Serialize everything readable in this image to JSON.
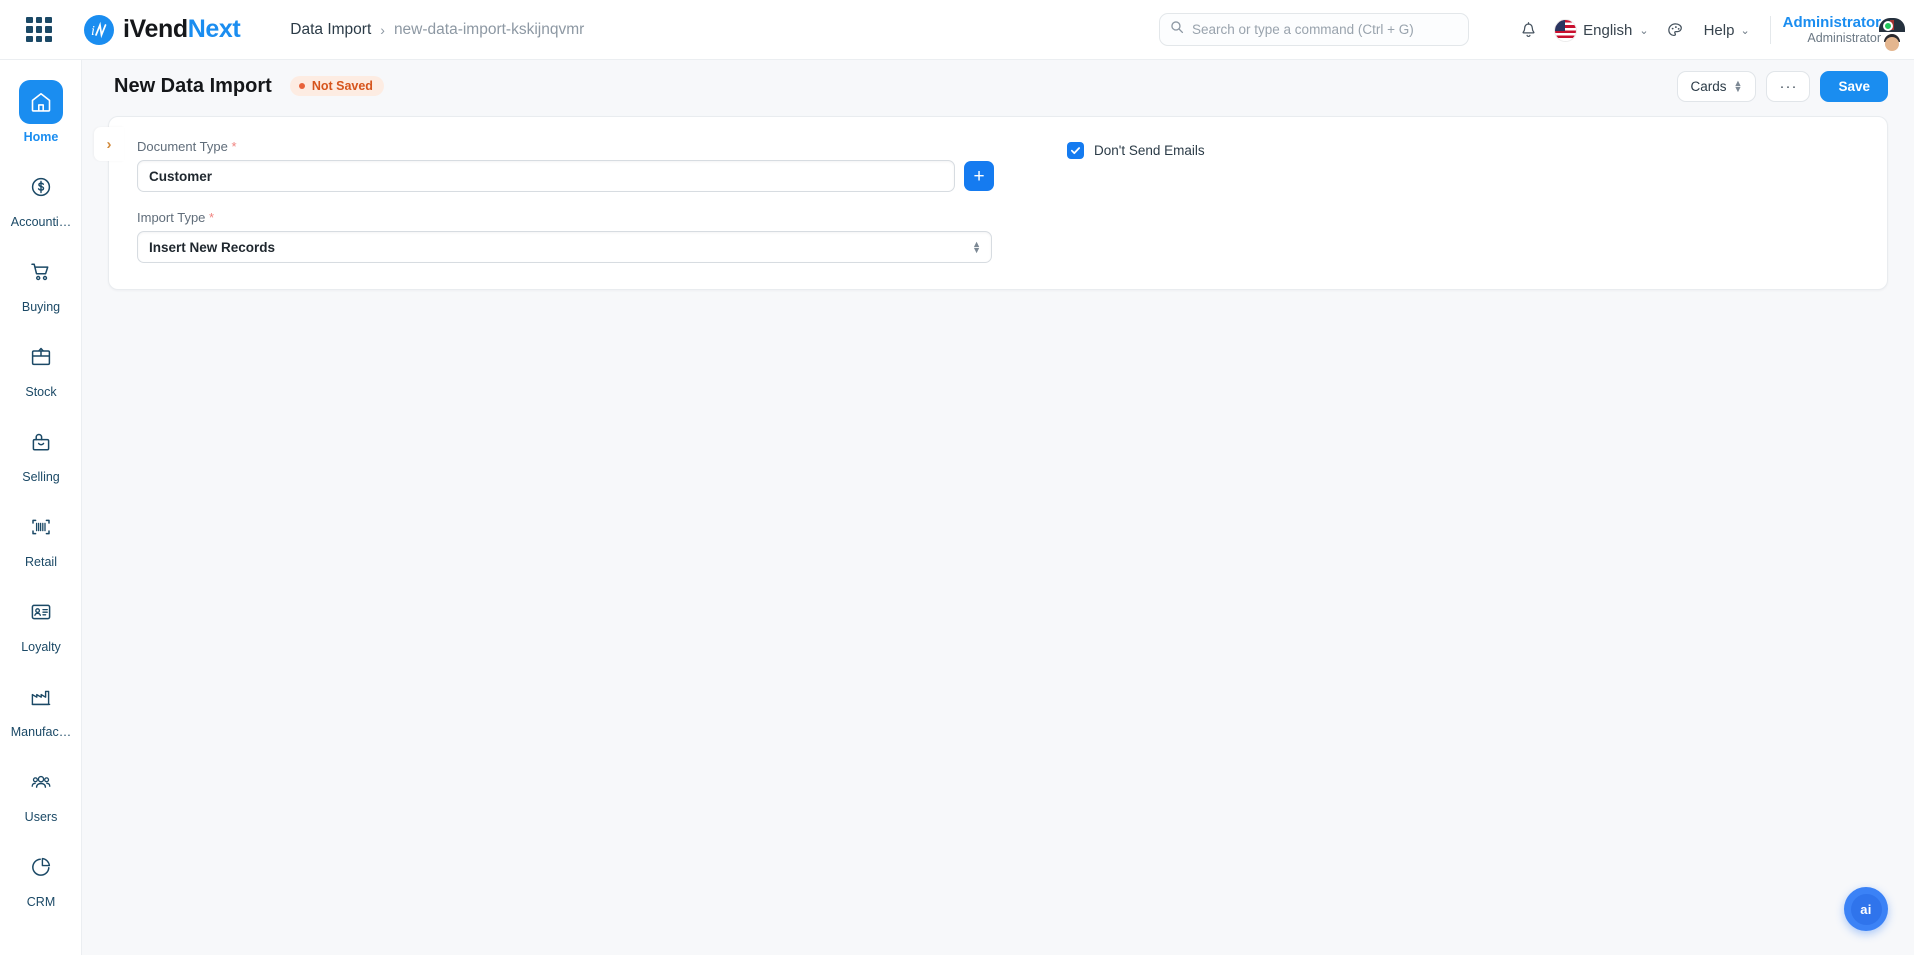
{
  "header": {
    "apps_icon": "apps-grid-icon",
    "brand": {
      "part1": "iVend",
      "part2": "Next",
      "mark": "in-logo-icon"
    },
    "breadcrumb": {
      "root": "Data Import",
      "separator": "›",
      "leaf": "new-data-import-kskijnqvmr"
    },
    "search": {
      "placeholder": "Search or type a command (Ctrl + G)",
      "value": "",
      "icon": "search-icon"
    },
    "bell_icon": "notification-bell-icon",
    "language": {
      "label": "English",
      "flag": "us-flag-icon",
      "chevron": "⌄"
    },
    "theme_icon": "palette-icon",
    "help": {
      "label": "Help",
      "chevron": "⌄"
    },
    "user": {
      "name": "Administrator",
      "role": "Administrator",
      "status": "online"
    }
  },
  "sidebar": {
    "items": [
      {
        "label": "Home",
        "icon": "home-icon",
        "active": true
      },
      {
        "label": "Accounti…",
        "icon": "dollar-circle-icon",
        "active": false
      },
      {
        "label": "Buying",
        "icon": "shopping-cart-icon",
        "active": false
      },
      {
        "label": "Stock",
        "icon": "box-icon",
        "active": false
      },
      {
        "label": "Selling",
        "icon": "shopping-bag-icon",
        "active": false
      },
      {
        "label": "Retail",
        "icon": "barcode-icon",
        "active": false
      },
      {
        "label": "Loyalty",
        "icon": "id-card-icon",
        "active": false
      },
      {
        "label": "Manufac…",
        "icon": "factory-icon",
        "active": false
      },
      {
        "label": "Users",
        "icon": "users-icon",
        "active": false
      },
      {
        "label": "CRM",
        "icon": "pie-chart-icon",
        "active": false
      }
    ]
  },
  "page": {
    "title": "New Data Import",
    "status_badge": "Not Saved",
    "actions": {
      "view_mode": "Cards",
      "menu": "···",
      "save": "Save"
    }
  },
  "form": {
    "collapse_chevron": "›",
    "document_type": {
      "label": "Document Type",
      "required": "*",
      "value": "Customer",
      "add_button": "+"
    },
    "import_type": {
      "label": "Import Type",
      "required": "*",
      "value": "Insert New Records"
    },
    "dont_send_emails": {
      "label": "Don't Send Emails",
      "checked": true
    }
  },
  "fab": {
    "label": "ai"
  },
  "colors": {
    "accent": "#1a8df0",
    "primary_button": "#1a8df0",
    "badge_text": "#d6551d",
    "badge_bg": "#fdece2",
    "sidebar_icon": "#1b4966",
    "page_bg": "#f7f8fa"
  }
}
